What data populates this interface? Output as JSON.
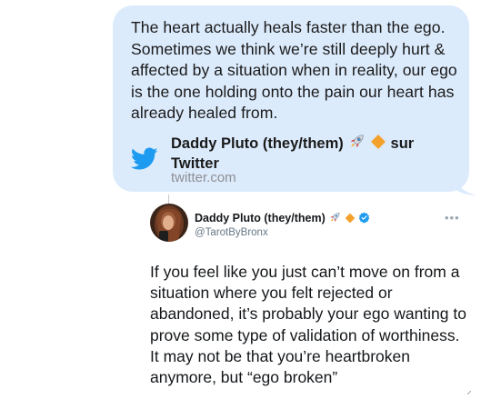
{
  "message": {
    "text": "The heart actually heals faster than the ego. Sometimes we think we’re still deeply hurt & affected by a situation when in reality, our ego is the one holding onto the pain our heart has already healed from.",
    "link_title": "Daddy Pluto (they/them) 🚀 🔶 sur Twitter",
    "link_title_text": "Daddy Pluto (they/them)",
    "link_title_suffix": "sur",
    "link_title_line2": "Twitter",
    "link_url": "twitter.com",
    "bubble_color": "#dcebfc"
  },
  "tweet": {
    "author_name": "Daddy Pluto (they/them)",
    "handle": "@TarotByBronx",
    "more_label": "•••",
    "text": "If you feel like you just can’t move on from a situation where you felt rejected or abandoned, it’s probably your ego wanting to prove some type of validation of worthiness. It may not be that you’re heartbroken anymore, but “ego broken”"
  },
  "icons": {
    "twitter": "twitter-bird-icon",
    "rocket": "rocket-icon",
    "diamond": "orange-diamond-icon",
    "verified": "verified-badge-icon"
  },
  "colors": {
    "twitter_blue": "#1d9bf0",
    "diamond_orange": "#f4a12b",
    "text_dark": "#1a1a1a",
    "muted": "#8e8e93"
  }
}
